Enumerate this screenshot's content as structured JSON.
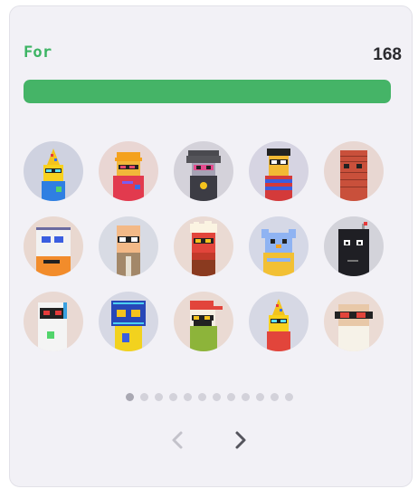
{
  "vote": {
    "label": "For",
    "count": "168",
    "progress_fraction": 1.0
  },
  "colors": {
    "accent_green": "#45b467",
    "label_green": "#3cb463",
    "card_background": "#f2f1f6"
  },
  "avatars": [
    {
      "icon": "party-hat-pixel-avatar"
    },
    {
      "icon": "orange-cap-pixel-avatar"
    },
    {
      "icon": "dark-hair-pixel-avatar"
    },
    {
      "icon": "striped-shirt-pixel-avatar"
    },
    {
      "icon": "brick-head-pixel-avatar"
    },
    {
      "icon": "computer-screen-pixel-avatar"
    },
    {
      "icon": "bald-glasses-pixel-avatar"
    },
    {
      "icon": "popcorn-pixel-avatar"
    },
    {
      "icon": "blue-bird-pixel-avatar"
    },
    {
      "icon": "black-bomb-pixel-avatar"
    },
    {
      "icon": "white-robot-pixel-avatar"
    },
    {
      "icon": "tv-screen-pixel-avatar"
    },
    {
      "icon": "red-cap-pixel-avatar"
    },
    {
      "icon": "party-hat-red-shirt-pixel-avatar"
    },
    {
      "icon": "sunglasses-pixel-avatar"
    }
  ],
  "pagination": {
    "total_pages": 12,
    "current_page": 1
  },
  "nav": {
    "prev_icon": "chevron-left-icon",
    "next_icon": "chevron-right-icon"
  }
}
